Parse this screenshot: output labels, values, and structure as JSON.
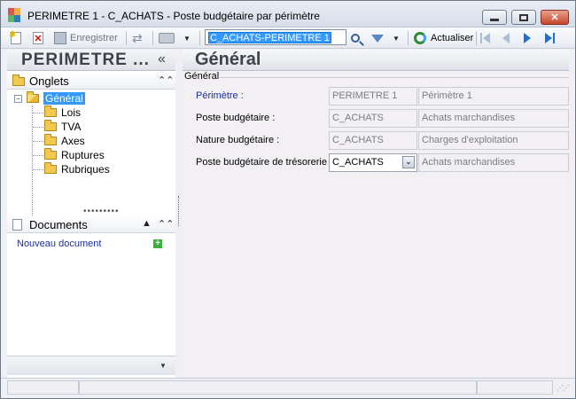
{
  "window": {
    "title": "PERIMETRE 1 - C_ACHATS -  Poste budgétaire par périmètre"
  },
  "toolbar": {
    "save_label": "Enregistrer",
    "search_value": "C_ACHATS-PERIMETRE 1",
    "refresh_label": "Actualiser"
  },
  "left_panel": {
    "title": "PERIMETRE ...",
    "onglets_label": "Onglets",
    "tree": [
      {
        "label": "Général",
        "selected": true
      },
      {
        "label": "Lois"
      },
      {
        "label": "TVA"
      },
      {
        "label": "Axes"
      },
      {
        "label": "Ruptures"
      },
      {
        "label": "Rubriques"
      }
    ],
    "documents_label": "Documents",
    "new_document_label": "Nouveau document"
  },
  "main": {
    "title": "Général",
    "group_label": "Général",
    "fields": [
      {
        "label": "Périmètre :",
        "code": "PERIMETRE 1",
        "description": "Périmètre 1"
      },
      {
        "label": "Poste budgétaire :",
        "code": "C_ACHATS",
        "description": "Achats marchandises"
      },
      {
        "label": "Nature budgétaire :",
        "code": "C_ACHATS",
        "description": "Charges d'exploitation"
      },
      {
        "label": "Poste budgétaire de trésorerie :",
        "code": "C_ACHATS",
        "description": "Achats marchandises"
      }
    ]
  },
  "colors": {
    "selection": "#3399ff",
    "link": "#1a2fa0",
    "close_button": "#c7462c"
  }
}
